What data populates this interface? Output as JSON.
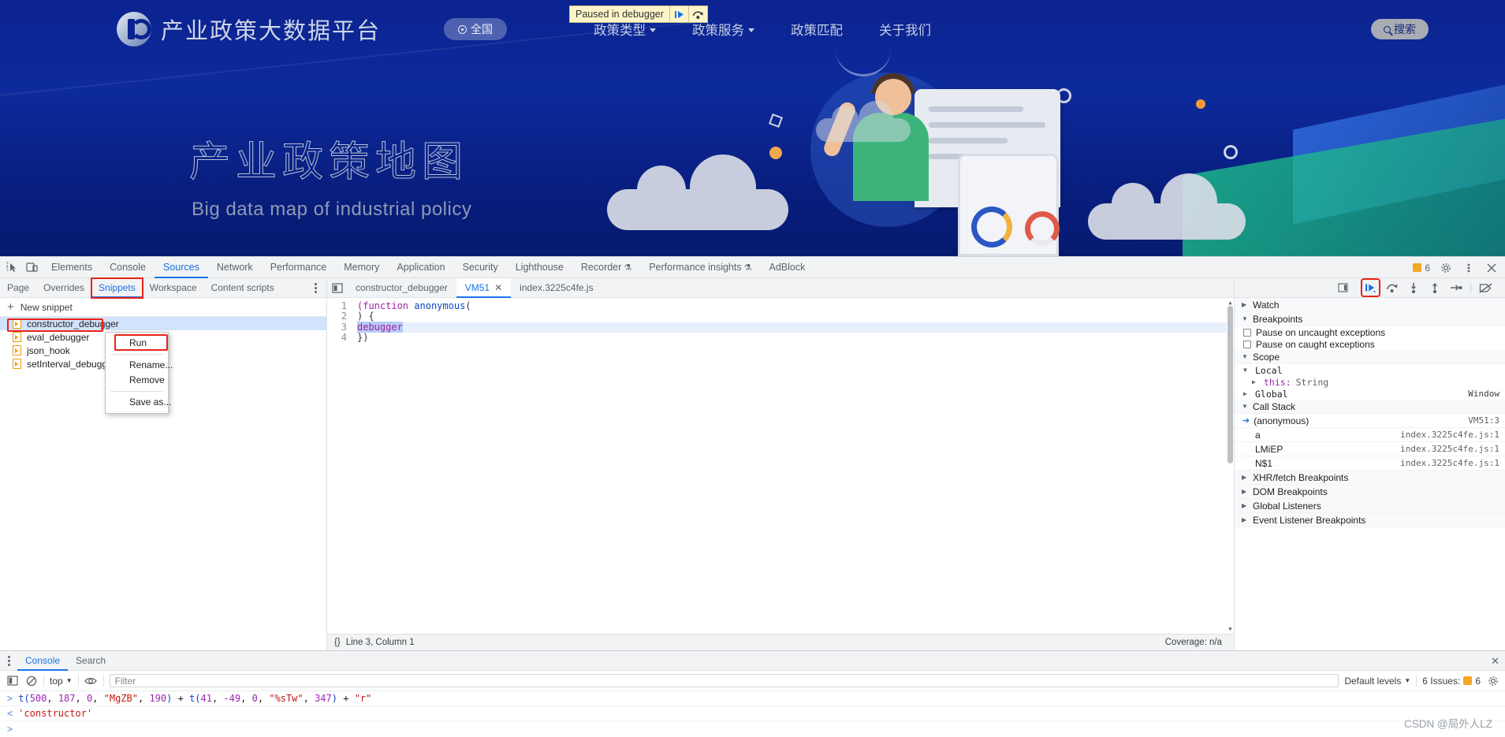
{
  "site": {
    "logo_text": "产业政策大数据平台",
    "region_button": "全国",
    "nav": [
      {
        "label": "政策类型",
        "has_caret": true
      },
      {
        "label": "政策服务",
        "has_caret": true
      },
      {
        "label": "政策匹配",
        "has_caret": false
      },
      {
        "label": "关于我们",
        "has_caret": false
      }
    ],
    "search_button": "搜索",
    "paused_banner": {
      "label": "Paused in debugger",
      "resume_icon": "resume-script-icon",
      "step_icon": "step-over-icon"
    },
    "hero_title": "产业政策地图",
    "hero_subtitle": "Big data map of industrial policy"
  },
  "devtools": {
    "tabs": [
      {
        "label": "Elements",
        "active": false
      },
      {
        "label": "Console",
        "active": false
      },
      {
        "label": "Sources",
        "active": true
      },
      {
        "label": "Network",
        "active": false
      },
      {
        "label": "Performance",
        "active": false
      },
      {
        "label": "Memory",
        "active": false
      },
      {
        "label": "Application",
        "active": false
      },
      {
        "label": "Security",
        "active": false
      },
      {
        "label": "Lighthouse",
        "active": false
      },
      {
        "label": "Recorder",
        "active": false,
        "flask": "⚗"
      },
      {
        "label": "Performance insights",
        "active": false,
        "flask": "⚗"
      },
      {
        "label": "AdBlock",
        "active": false
      }
    ],
    "issues_count": "6",
    "navigator": {
      "subtabs": [
        {
          "label": "Page",
          "active": false
        },
        {
          "label": "Overrides",
          "active": false
        },
        {
          "label": "Snippets",
          "active": true,
          "highlighted": true
        },
        {
          "label": "Workspace",
          "active": false
        },
        {
          "label": "Content scripts",
          "active": false
        }
      ],
      "new_snippet": "New snippet",
      "snippets": [
        {
          "name": "constructor_debugger",
          "selected": true,
          "highlighted": true
        },
        {
          "name": "eval_debugger",
          "selected": false
        },
        {
          "name": "json_hook",
          "selected": false
        },
        {
          "name": "setInterval_debugger",
          "selected": false
        }
      ]
    },
    "context_menu": {
      "items": [
        {
          "label": "Run",
          "highlighted": true
        },
        {
          "label": "Rename...",
          "highlighted": false
        },
        {
          "label": "Remove",
          "highlighted": false
        },
        {
          "label": "Save as...",
          "highlighted": false
        }
      ]
    },
    "editor": {
      "tabs": [
        {
          "label": "constructor_debugger",
          "active": false,
          "closable": false
        },
        {
          "label": "VM51",
          "active": true,
          "closable": true
        },
        {
          "label": "index.3225c4fe.js",
          "active": false,
          "closable": false
        }
      ],
      "lines": [
        {
          "n": "1",
          "text": "(function anonymous("
        },
        {
          "n": "2",
          "text": ") {"
        },
        {
          "n": "3",
          "text": "debugger"
        },
        {
          "n": "4",
          "text": "})"
        }
      ],
      "status_position": "Line 3, Column 1",
      "status_coverage": "Coverage: n/a",
      "brace_icon": "{}"
    },
    "debugger": {
      "toolbar_buttons": [
        {
          "name": "resume-script-button",
          "highlighted": true
        },
        {
          "name": "step-over-button",
          "highlighted": false
        },
        {
          "name": "step-into-button",
          "highlighted": false
        },
        {
          "name": "step-out-button",
          "highlighted": false
        },
        {
          "name": "step-button",
          "highlighted": false
        },
        {
          "name": "deactivate-breakpoints-button",
          "highlighted": false
        }
      ],
      "watch": "Watch",
      "breakpoints_section": "Breakpoints",
      "pause_uncaught": "Pause on uncaught exceptions",
      "pause_caught": "Pause on caught exceptions",
      "scope_section": "Scope",
      "scope": {
        "local": "Local",
        "this_key": "this:",
        "this_val": "String",
        "global": "Global",
        "global_val": "Window"
      },
      "call_stack_section": "Call Stack",
      "call_stack": [
        {
          "fn": "(anonymous)",
          "loc": "VM51:3",
          "current": true
        },
        {
          "fn": "a",
          "loc": "index.3225c4fe.js:1",
          "current": false
        },
        {
          "fn": "LMiEP",
          "loc": "index.3225c4fe.js:1",
          "current": false
        },
        {
          "fn": "N$1",
          "loc": "index.3225c4fe.js:1",
          "current": false
        }
      ],
      "sections": [
        "XHR/fetch Breakpoints",
        "DOM Breakpoints",
        "Global Listeners",
        "Event Listener Breakpoints"
      ]
    },
    "drawer": {
      "tabs": [
        {
          "label": "Console",
          "active": true
        },
        {
          "label": "Search",
          "active": false
        }
      ],
      "context_select": "top",
      "filter_placeholder": "Filter",
      "levels": "Default levels",
      "issues_label": "6 Issues:",
      "issues_count": "6",
      "console_input_tokens": [
        {
          "t": "t(",
          "c": "fn"
        },
        {
          "t": "500",
          "c": "num"
        },
        {
          "t": ", ",
          "c": "plain"
        },
        {
          "t": "187",
          "c": "num"
        },
        {
          "t": ", ",
          "c": "plain"
        },
        {
          "t": "0",
          "c": "num"
        },
        {
          "t": ", ",
          "c": "plain"
        },
        {
          "t": "\"MgZB\"",
          "c": "str"
        },
        {
          "t": ", ",
          "c": "plain"
        },
        {
          "t": "190",
          "c": "num"
        },
        {
          "t": ") + ",
          "c": "fn"
        },
        {
          "t": "t(",
          "c": "fn"
        },
        {
          "t": "41",
          "c": "num"
        },
        {
          "t": ", ",
          "c": "plain"
        },
        {
          "t": "-49",
          "c": "num"
        },
        {
          "t": ", ",
          "c": "plain"
        },
        {
          "t": "0",
          "c": "num"
        },
        {
          "t": ", ",
          "c": "plain"
        },
        {
          "t": "\"%sTw\"",
          "c": "str"
        },
        {
          "t": ", ",
          "c": "plain"
        },
        {
          "t": "347",
          "c": "num"
        },
        {
          "t": ") + ",
          "c": "fn"
        },
        {
          "t": "\"r\"",
          "c": "str"
        }
      ],
      "console_result": "'constructor'"
    }
  },
  "watermark": "CSDN @局外人LZ",
  "colors": {
    "accent_blue": "#1a73e8",
    "highlight_red": "#e8241a",
    "page_blue": "#0b2390",
    "snippet_orange": "#f29900"
  }
}
